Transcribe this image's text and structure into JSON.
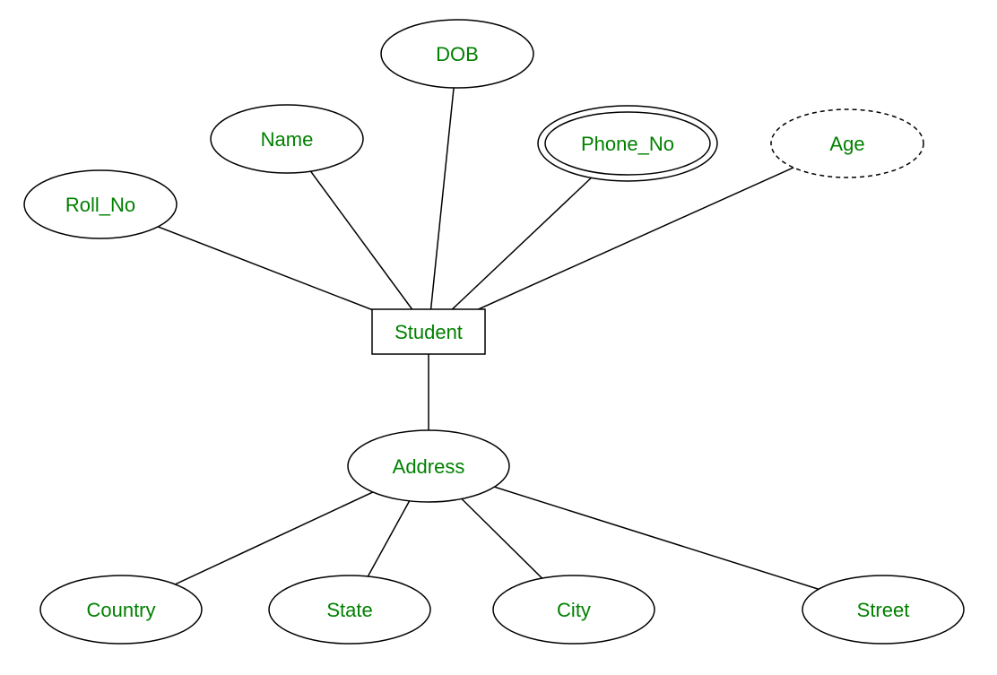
{
  "diagram": {
    "entity": {
      "label": "Student"
    },
    "attributes": {
      "roll_no": {
        "label": "Roll_No"
      },
      "name": {
        "label": "Name"
      },
      "dob": {
        "label": "DOB"
      },
      "phone_no": {
        "label": "Phone_No"
      },
      "age": {
        "label": "Age"
      },
      "address": {
        "label": "Address"
      }
    },
    "address_sub": {
      "country": {
        "label": "Country"
      },
      "state": {
        "label": "State"
      },
      "city": {
        "label": "City"
      },
      "street": {
        "label": "Street"
      }
    }
  }
}
